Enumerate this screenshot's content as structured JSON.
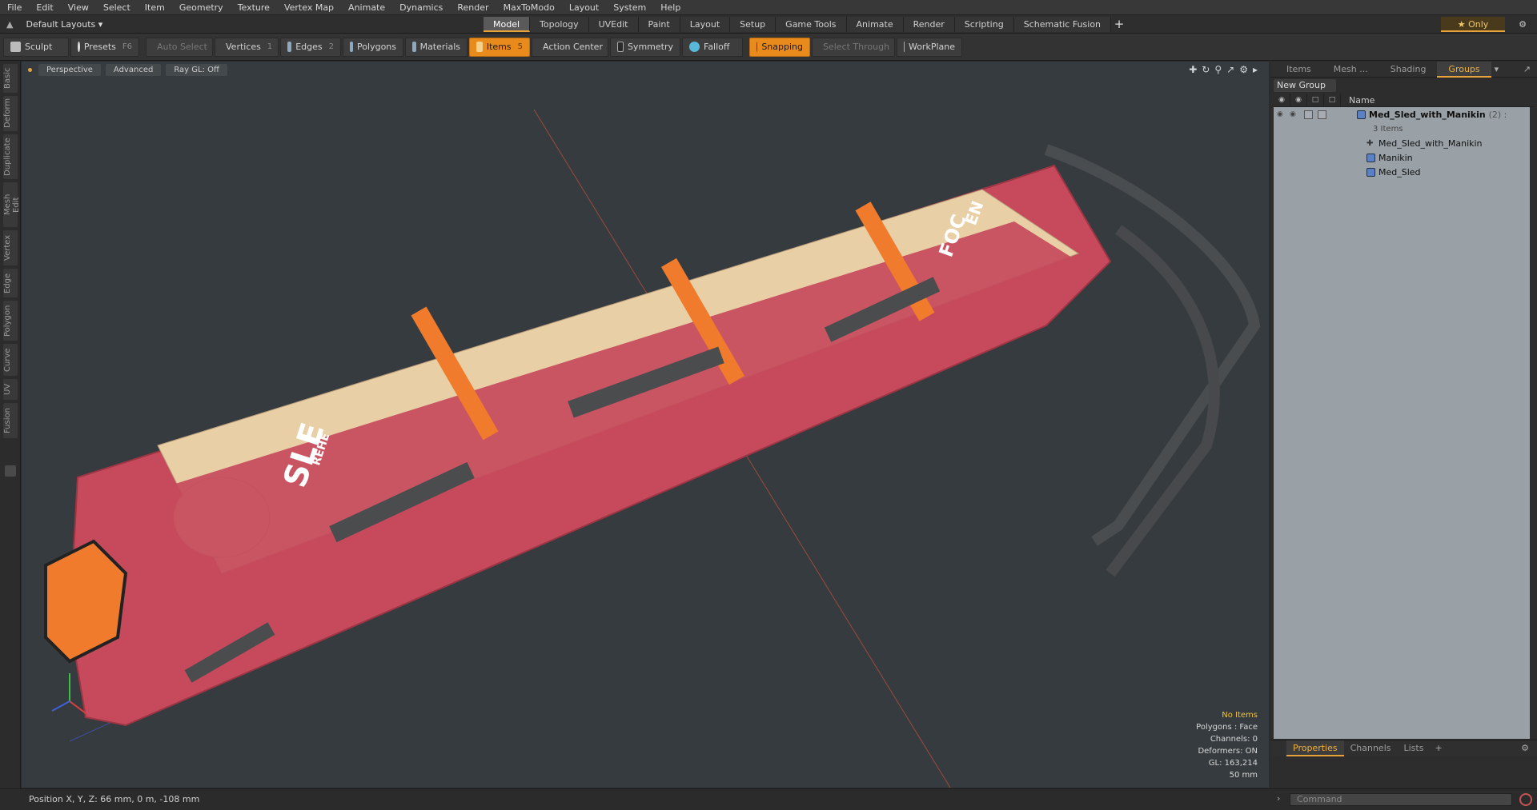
{
  "menu": [
    "File",
    "Edit",
    "View",
    "Select",
    "Item",
    "Geometry",
    "Texture",
    "Vertex Map",
    "Animate",
    "Dynamics",
    "Render",
    "MaxToModo",
    "Layout",
    "System",
    "Help"
  ],
  "layout_selector": "Default Layouts ▾",
  "mode_tabs": [
    "Model",
    "Topology",
    "UVEdit",
    "Paint",
    "Layout",
    "Setup",
    "Game Tools",
    "Animate",
    "Render",
    "Scripting",
    "Schematic Fusion"
  ],
  "active_mode_tab": "Model",
  "only_label": "★ Only",
  "toolbar": {
    "sculpt": "Sculpt",
    "presets": "Presets",
    "presets_key": "F6",
    "auto_select": "Auto Select",
    "vertices": "Vertices",
    "vertices_num": "1",
    "edges": "Edges",
    "edges_num": "2",
    "polygons": "Polygons",
    "materials": "Materials",
    "items": "Items",
    "items_num": "5",
    "action_center": "Action Center",
    "symmetry": "Symmetry",
    "falloff": "Falloff",
    "snapping": "Snapping",
    "select_through": "Select Through",
    "workplane": "WorkPlane"
  },
  "left_tabs": [
    "Basic",
    "Deform",
    "Duplicate",
    "Mesh Edit",
    "Vertex",
    "Edge",
    "Polygon",
    "Curve",
    "UV",
    "Fusion"
  ],
  "viewport": {
    "view": "Perspective",
    "shading": "Advanced",
    "raygl": "Ray GL: Off",
    "info": {
      "items": "No Items",
      "polygons": "Polygons : Face",
      "channels": "Channels: 0",
      "deformers": "Deformers: ON",
      "gl": "GL: 163,214",
      "scale": "50 mm"
    },
    "sled_texts": [
      "SLE",
      "FOC",
      "REHE",
      "EN"
    ]
  },
  "right_panel": {
    "tabs": [
      "Items",
      "Mesh ...",
      "Shading",
      "Groups"
    ],
    "active_tab": "Groups",
    "new_group": "New Group",
    "column_name": "Name",
    "tree": {
      "root": "Med_Sled_with_Manikin",
      "root_count": "(2) :",
      "root_sub": "3 Items",
      "children": [
        "Med_Sled_with_Manikin",
        "Manikin",
        "Med_Sled"
      ]
    },
    "bottom_tabs": [
      "Properties",
      "Channels",
      "Lists"
    ],
    "bottom_active": "Properties"
  },
  "status": "Position X, Y, Z:  66 mm, 0 m, -108 mm",
  "command_placeholder": "Command",
  "colors": {
    "accent": "#e88a1c",
    "sled": "#c64a5c",
    "strap": "#f07b2c",
    "skin": "#e9cfa6",
    "viewport": "#353b3e"
  }
}
